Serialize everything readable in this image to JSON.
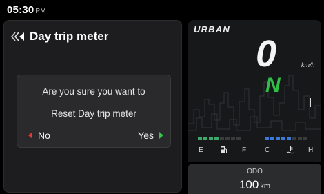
{
  "status": {
    "time": "05:30",
    "ampm": "PM"
  },
  "menu": {
    "title": "Day trip meter",
    "back_icon": "triple-chevron-left-icon"
  },
  "dialog": {
    "line1": "Are you sure you want to",
    "line2": "Reset Day trip meter",
    "no_label": "No",
    "yes_label": "Yes"
  },
  "cluster": {
    "mode": "URBAN",
    "speed": "0",
    "speed_unit": "km/h",
    "gear": "N",
    "fuel": {
      "empty_label": "E",
      "full_label": "F",
      "level_segments": 4,
      "total_segments": 8,
      "icon": "fuel-pump-icon"
    },
    "temp": {
      "cold_label": "C",
      "hot_label": "H",
      "level_segments": 5,
      "total_segments": 8,
      "icon": "coolant-temp-icon"
    }
  },
  "odo": {
    "label": "ODO",
    "value": "100",
    "unit": "km"
  },
  "colors": {
    "gear_green": "#2fbf48",
    "no_arrow": "#e03a3a",
    "yes_arrow": "#34c24a",
    "fuel_bar": "#3ea86a",
    "temp_bar": "#3b7ad4"
  }
}
